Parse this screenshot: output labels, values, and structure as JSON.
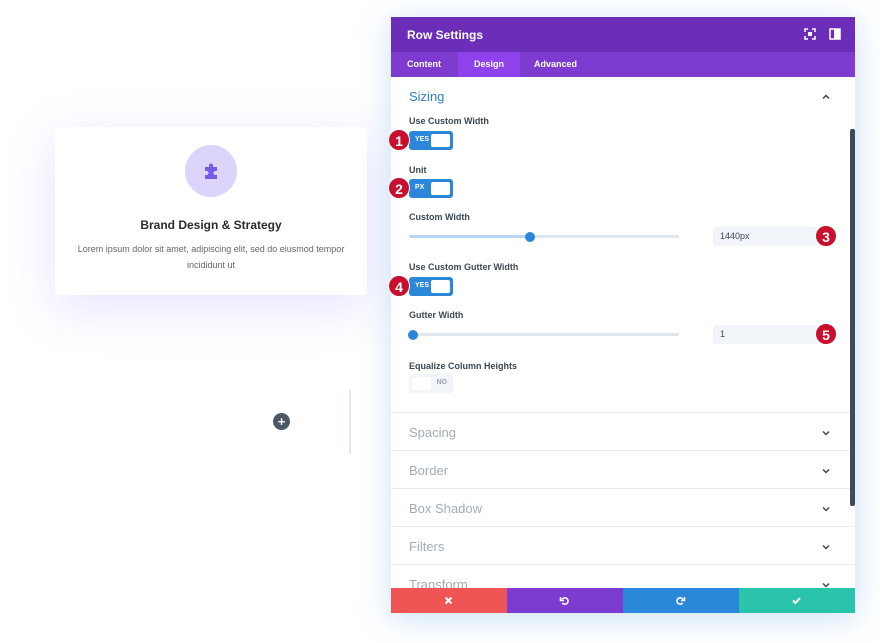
{
  "card": {
    "icon": "puzzle-icon",
    "title": "Brand Design & Strategy",
    "text": "Lorem ipsum dolor sit amet, adipiscing elit, sed do eiusmod tempor incididunt ut"
  },
  "add_button": "+",
  "panel": {
    "title": "Row Settings",
    "header_icons": [
      "fullscreen-icon",
      "sidebar-toggle-icon"
    ],
    "tabs": [
      {
        "label": "Content",
        "active": false
      },
      {
        "label": "Design",
        "active": true
      },
      {
        "label": "Advanced",
        "active": false
      }
    ],
    "sizing": {
      "title": "Sizing",
      "use_custom_width": {
        "label": "Use Custom Width",
        "value": "YES"
      },
      "unit": {
        "label": "Unit",
        "value": "PX"
      },
      "custom_width": {
        "label": "Custom Width",
        "value": "1440px",
        "slider_fraction": 0.45
      },
      "use_custom_gutter": {
        "label": "Use Custom Gutter Width",
        "value": "YES"
      },
      "gutter_width": {
        "label": "Gutter Width",
        "value": "1",
        "slider_fraction": 0.0
      },
      "equalize": {
        "label": "Equalize Column Heights",
        "value": "NO"
      }
    },
    "sections": [
      "Spacing",
      "Border",
      "Box Shadow",
      "Filters",
      "Transform"
    ],
    "markers": [
      "1",
      "2",
      "3",
      "4",
      "5"
    ],
    "footer": {
      "cancel_color": "#ef5555",
      "undo_color": "#7e3bd0",
      "redo_color": "#2b87da",
      "save_color": "#29c4a9"
    }
  },
  "colors": {
    "header": "#6c2eb9",
    "tabs": "#7e3bd0",
    "accent": "#2b87da",
    "marker": "#c8102e"
  }
}
